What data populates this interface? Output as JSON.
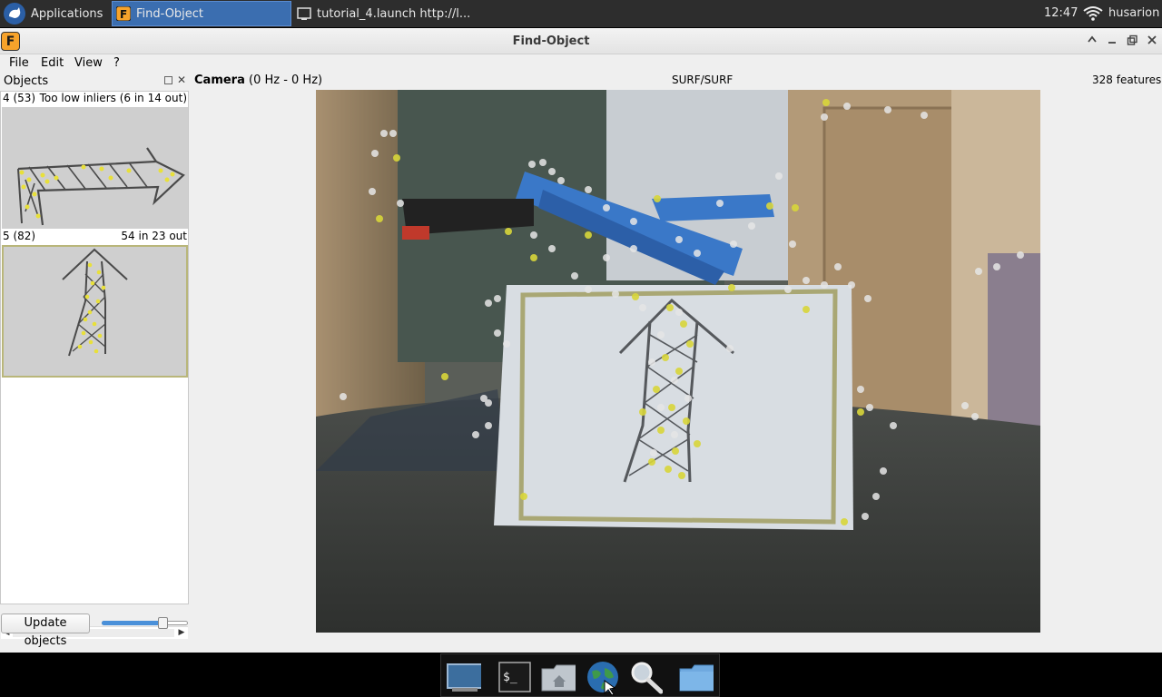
{
  "top_panel": {
    "applications_label": "Applications",
    "tasks": [
      {
        "label": "Find-Object",
        "active": true
      },
      {
        "label": "tutorial_4.launch http://l...",
        "active": false
      }
    ],
    "clock": "12:47",
    "user": "husarion"
  },
  "window": {
    "title": "Find-Object",
    "logo_letter": "F"
  },
  "menu": {
    "items": [
      "File",
      "Edit",
      "View",
      "?"
    ]
  },
  "objects_panel": {
    "title": "Objects",
    "objects": [
      {
        "left_text": "4 (53)",
        "right_text": "Too low inliers (6 in 14 out)"
      },
      {
        "left_text": "5 (82)",
        "right_text": "54 in 23 out"
      }
    ],
    "update_button": "Update objects",
    "slider_value": 0.7
  },
  "camera": {
    "title": "Camera",
    "rate": "(0 Hz - 0 Hz)",
    "detector": "SURF/SURF",
    "features": "328 features"
  },
  "dock": {
    "items": [
      "monitor-icon",
      "terminal-icon",
      "home-folder-icon",
      "web-browser-icon",
      "search-icon",
      "folder-icon"
    ],
    "terminal_label": "$_"
  },
  "colors": {
    "accent": "#3b6eb0",
    "keypoint_match": "#d8d63a",
    "keypoint_other": "#e6e6e6",
    "detection_box": "#a9a774"
  }
}
